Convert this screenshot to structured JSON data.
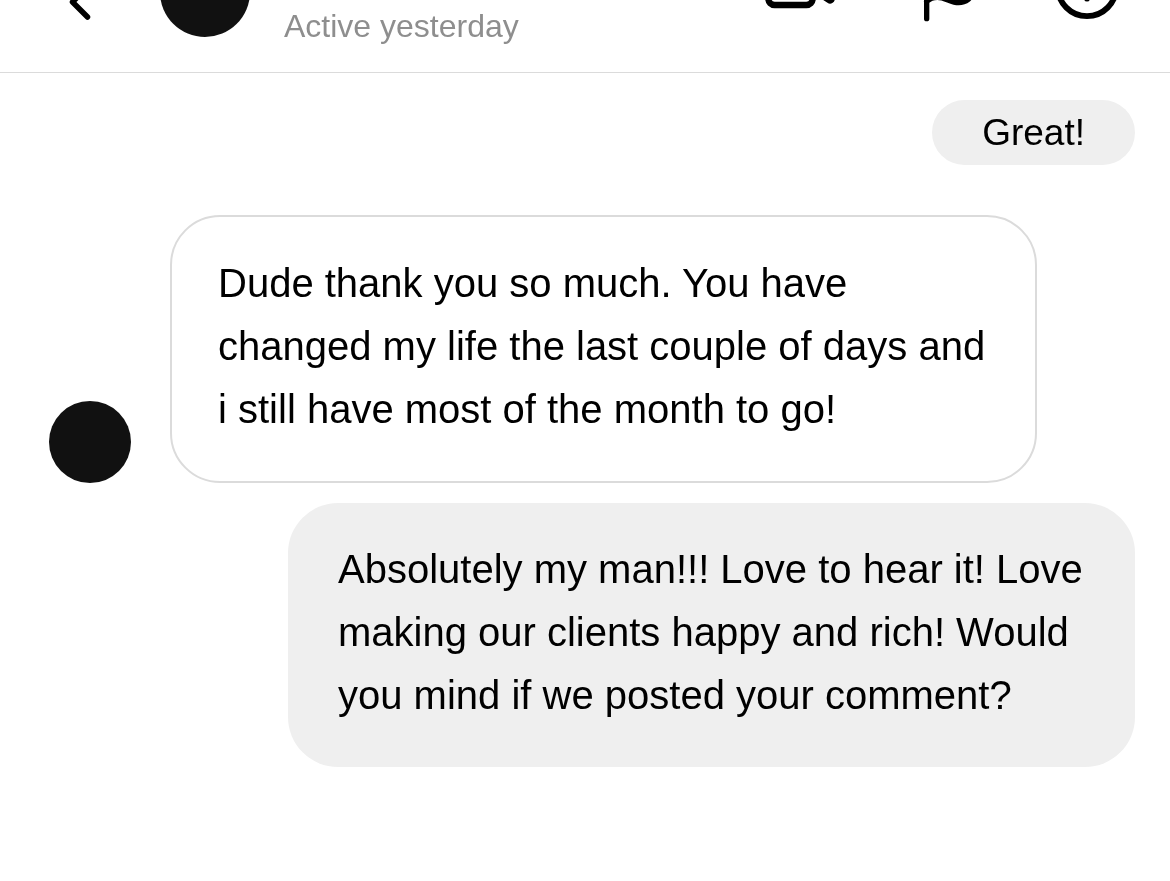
{
  "header": {
    "status": "Active yesterday"
  },
  "messages": [
    {
      "kind": "sent",
      "text": "Great!"
    },
    {
      "kind": "received",
      "text": "Dude thank you so much. You have changed my life the last couple of days and i still have most of the month to go!"
    },
    {
      "kind": "sent",
      "text": "Absolutely my man!!! Love to hear it! Love making our clients happy and rich! Would you mind if we posted your comment?"
    }
  ]
}
